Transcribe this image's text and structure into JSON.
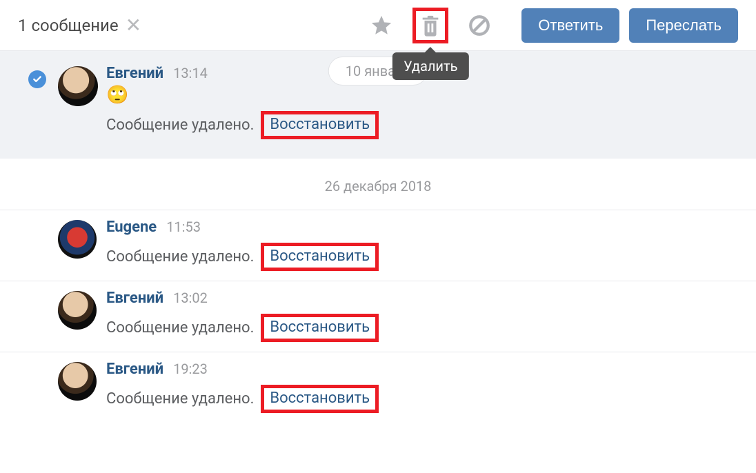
{
  "toolbar": {
    "selection_text": "1 сообщение",
    "tooltip_delete": "Удалить",
    "reply_label": "Ответить",
    "forward_label": "Переслать"
  },
  "date_pill": "10 января",
  "date_divider": "26 декабря 2018",
  "deleted_text": "Сообщение удалено.",
  "restore_text": "Восстановить",
  "messages": [
    {
      "name": "Евгений",
      "time": "13:14",
      "emoji": "🙄",
      "avatar": "av1",
      "selected": true,
      "show_emoji": true
    },
    {
      "name": "Eugene",
      "time": "11:53",
      "avatar": "av2"
    },
    {
      "name": "Евгений",
      "time": "13:02",
      "avatar": "av1"
    },
    {
      "name": "Евгений",
      "time": "19:23",
      "avatar": "av1"
    }
  ]
}
